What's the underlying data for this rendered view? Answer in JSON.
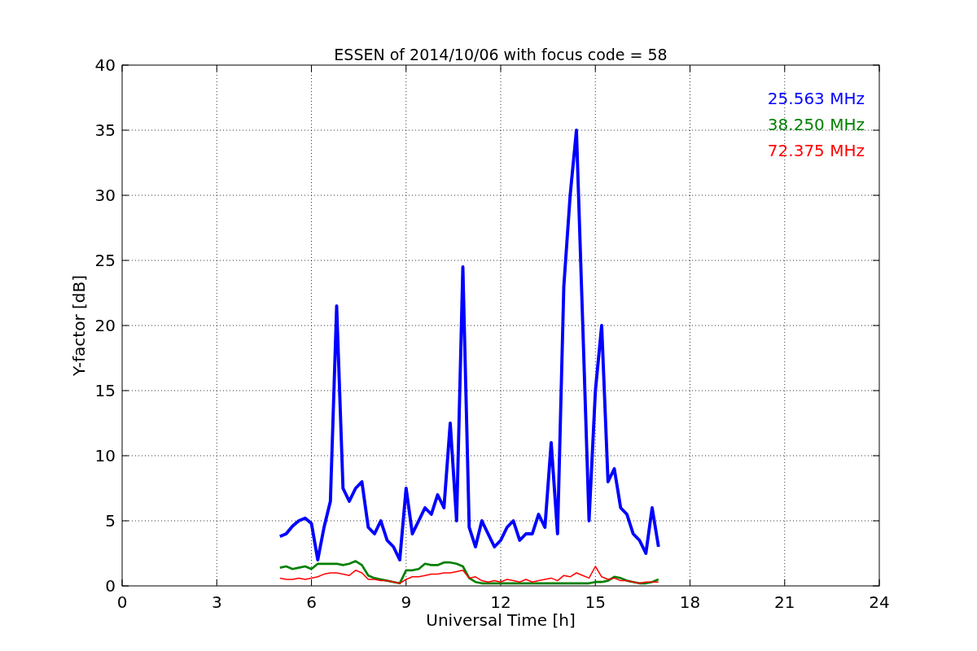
{
  "figure": {
    "chart_data": {
      "type": "line",
      "title": "ESSEN of 2014/10/06 with focus code = 58",
      "xlabel": "Universal Time [h]",
      "ylabel": "Y-factor [dB]",
      "x": [
        5.0,
        5.2,
        5.4,
        5.6,
        5.8,
        6.0,
        6.2,
        6.4,
        6.6,
        6.8,
        7.0,
        7.2,
        7.4,
        7.6,
        7.8,
        8.0,
        8.2,
        8.4,
        8.6,
        8.8,
        9.0,
        9.2,
        9.4,
        9.6,
        9.8,
        10.0,
        10.2,
        10.4,
        10.6,
        10.8,
        11.0,
        11.2,
        11.4,
        11.6,
        11.8,
        12.0,
        12.2,
        12.4,
        12.6,
        12.8,
        13.0,
        13.2,
        13.4,
        13.6,
        13.8,
        14.0,
        14.2,
        14.4,
        14.6,
        14.8,
        15.0,
        15.2,
        15.4,
        15.6,
        15.8,
        16.0,
        16.2,
        16.4,
        16.6,
        16.8,
        17.0
      ],
      "series": [
        {
          "name": "25.563 MHz",
          "color": "#0000ff",
          "values": [
            3.8,
            4.0,
            4.6,
            5.0,
            5.2,
            4.8,
            2.0,
            4.5,
            6.5,
            21.5,
            7.5,
            6.5,
            7.5,
            8.0,
            4.5,
            4.0,
            5.0,
            3.5,
            3.0,
            2.0,
            7.5,
            4.0,
            5.0,
            6.0,
            5.5,
            7.0,
            6.0,
            12.5,
            5.0,
            24.5,
            4.5,
            3.0,
            5.0,
            4.0,
            3.0,
            3.5,
            4.5,
            5.0,
            3.5,
            4.0,
            4.0,
            5.5,
            4.5,
            11.0,
            4.0,
            23.0,
            30.0,
            35.0,
            20.0,
            5.0,
            15.0,
            20.0,
            8.0,
            9.0,
            6.0,
            5.5,
            4.0,
            3.5,
            2.5,
            6.0,
            3.0
          ]
        },
        {
          "name": "38.250 MHz",
          "color": "#008000",
          "values": [
            1.4,
            1.5,
            1.3,
            1.4,
            1.5,
            1.3,
            1.7,
            1.7,
            1.7,
            1.7,
            1.6,
            1.7,
            1.9,
            1.6,
            0.8,
            0.6,
            0.5,
            0.4,
            0.3,
            0.2,
            1.2,
            1.2,
            1.3,
            1.7,
            1.6,
            1.6,
            1.8,
            1.8,
            1.7,
            1.5,
            0.6,
            0.3,
            0.2,
            0.2,
            0.2,
            0.2,
            0.2,
            0.2,
            0.2,
            0.2,
            0.2,
            0.2,
            0.2,
            0.2,
            0.2,
            0.2,
            0.2,
            0.2,
            0.2,
            0.2,
            0.3,
            0.3,
            0.4,
            0.7,
            0.6,
            0.4,
            0.3,
            0.2,
            0.2,
            0.3,
            0.5
          ]
        },
        {
          "name": "72.375 MHz",
          "color": "#ff0000",
          "values": [
            0.6,
            0.5,
            0.5,
            0.6,
            0.5,
            0.6,
            0.7,
            0.9,
            1.0,
            1.0,
            0.9,
            0.8,
            1.2,
            1.0,
            0.5,
            0.5,
            0.4,
            0.4,
            0.3,
            0.2,
            0.5,
            0.7,
            0.7,
            0.8,
            0.9,
            0.9,
            1.0,
            1.0,
            1.1,
            1.2,
            0.6,
            0.7,
            0.4,
            0.3,
            0.4,
            0.3,
            0.5,
            0.4,
            0.3,
            0.5,
            0.3,
            0.4,
            0.5,
            0.6,
            0.4,
            0.8,
            0.7,
            1.0,
            0.8,
            0.6,
            1.5,
            0.7,
            0.5,
            0.6,
            0.4,
            0.4,
            0.3,
            0.2,
            0.3,
            0.3,
            0.3
          ]
        }
      ],
      "grid": true,
      "xlim": [
        0,
        24
      ],
      "ylim": [
        0,
        40
      ],
      "xticks": [
        0,
        3,
        6,
        9,
        12,
        15,
        18,
        21,
        24
      ],
      "yticks": [
        0,
        5,
        10,
        15,
        20,
        25,
        30,
        35,
        40
      ]
    }
  }
}
